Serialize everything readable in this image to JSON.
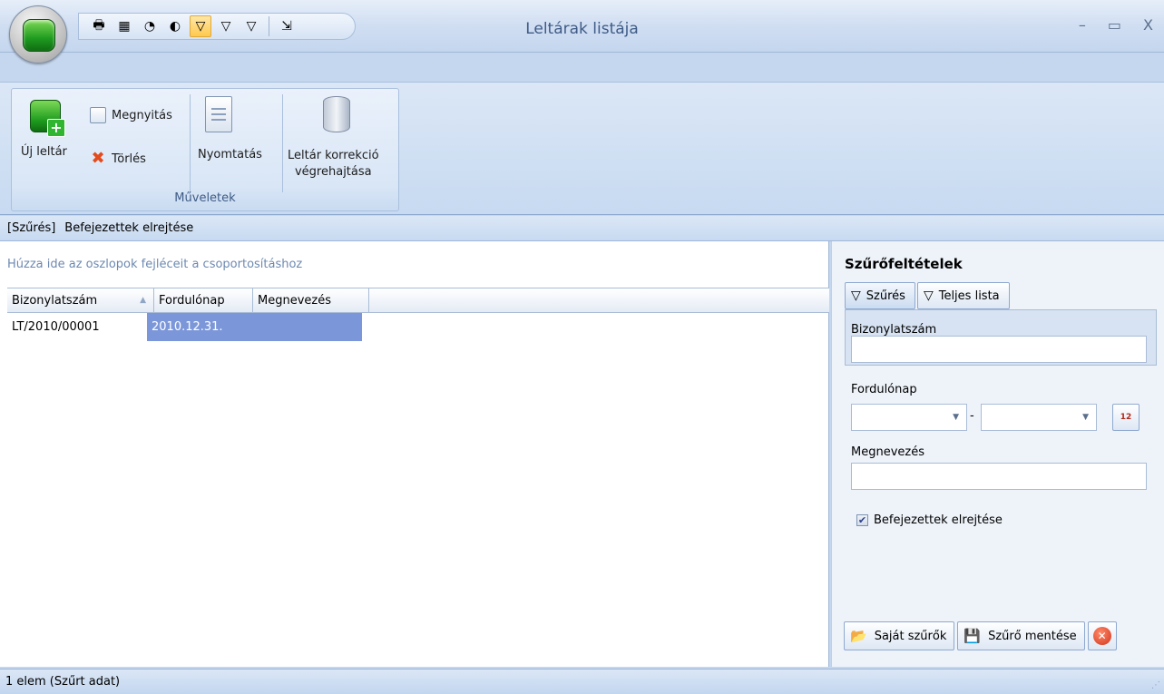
{
  "window": {
    "title": "Leltárak listája",
    "controls": {
      "minimize": "–",
      "maximize": "▭",
      "close": "X"
    }
  },
  "quick_access": [
    {
      "name": "print-icon",
      "glyph": "🖶"
    },
    {
      "name": "excel-icon",
      "glyph": "▦"
    },
    {
      "name": "chart-icon",
      "glyph": "◔"
    },
    {
      "name": "color-icon",
      "glyph": "◐"
    },
    {
      "name": "filter-icon",
      "glyph": "▽",
      "active": true
    },
    {
      "name": "filter-alt-icon",
      "glyph": "▽"
    },
    {
      "name": "filter-clear-icon",
      "glyph": "▽"
    },
    {
      "name": "export-icon",
      "glyph": "⇲"
    }
  ],
  "ribbon": {
    "new_label": "Új leltár",
    "open_label": "Megnyitás",
    "delete_label": "Törlés",
    "print_label": "Nyomtatás",
    "correction_label_line1": "Leltár korrekció",
    "correction_label_line2": "végrehajtása",
    "group_label": "Műveletek"
  },
  "filterbar": {
    "tag": "[Szűrés]",
    "text": "Befejezettek elrejtése"
  },
  "grid": {
    "group_hint": "Húzza ide az oszlopok fejléceit a csoportosításhoz",
    "columns": [
      "Bizonylatszám",
      "Fordulónap",
      "Megnevezés"
    ],
    "rows": [
      {
        "bizonylatszam": "LT/2010/00001",
        "fordulonap": "2010.12.31.",
        "megnevezes": ""
      }
    ]
  },
  "filter_panel": {
    "title": "Szűrőfeltételek",
    "tab_filter": "Szűrés",
    "tab_full_list": "Teljes lista",
    "field_docnum_label": "Bizonylatszám",
    "field_docnum_value": "",
    "field_date_label": "Fordulónap",
    "date_from": "",
    "date_to": "",
    "date_separator": "-",
    "calendar_glyph": "12",
    "field_name_label": "Megnevezés",
    "field_name_value": "",
    "hide_finished_label": "Befejezettek elrejtése",
    "hide_finished_checked": true,
    "my_filters_label": "Saját szűrők",
    "save_filter_label": "Szűrő mentése"
  },
  "status": {
    "text": "1 elem (Szűrt adat)"
  },
  "colors": {
    "selection": "#7c97d9",
    "accent": "#3e5b86",
    "app_green": "#1f9b1f"
  }
}
